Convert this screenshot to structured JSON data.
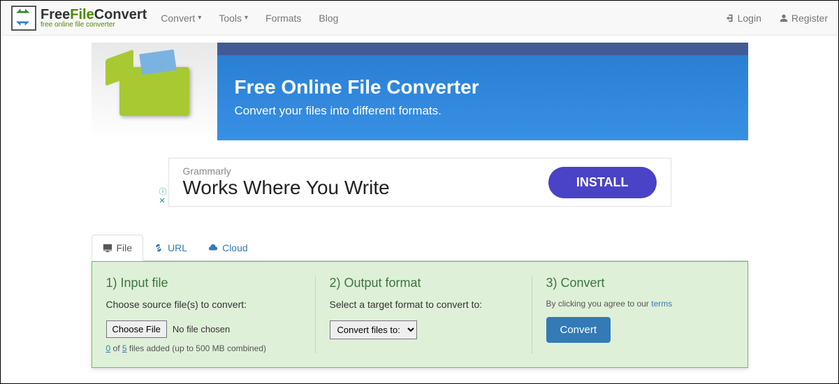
{
  "logo": {
    "title_free": "Free",
    "title_file": "File",
    "title_convert": "Convert",
    "sub": "free online file converter"
  },
  "nav": {
    "convert": "Convert",
    "tools": "Tools",
    "formats": "Formats",
    "blog": "Blog",
    "login": "Login",
    "register": "Register"
  },
  "banner": {
    "title": "Free Online File Converter",
    "sub": "Convert your files into different formats."
  },
  "ad": {
    "brand": "Grammarly",
    "headline": "Works Where You Write",
    "cta": "INSTALL"
  },
  "tabs": {
    "file": "File",
    "url": "URL",
    "cloud": "Cloud"
  },
  "step1": {
    "title": "1) Input file",
    "sub": "Choose source file(s) to convert:",
    "choose": "Choose File",
    "nofile": "No file chosen",
    "added": "0",
    "max": "5",
    "status_mid": " of ",
    "status_end": " files added (up to 500 MB combined)"
  },
  "step2": {
    "title": "2) Output format",
    "sub": "Select a target format to convert to:",
    "select": "Convert files to:"
  },
  "step3": {
    "title": "3) Convert",
    "terms_pre": "By clicking you agree to our ",
    "terms_link": "terms",
    "button": "Convert"
  }
}
